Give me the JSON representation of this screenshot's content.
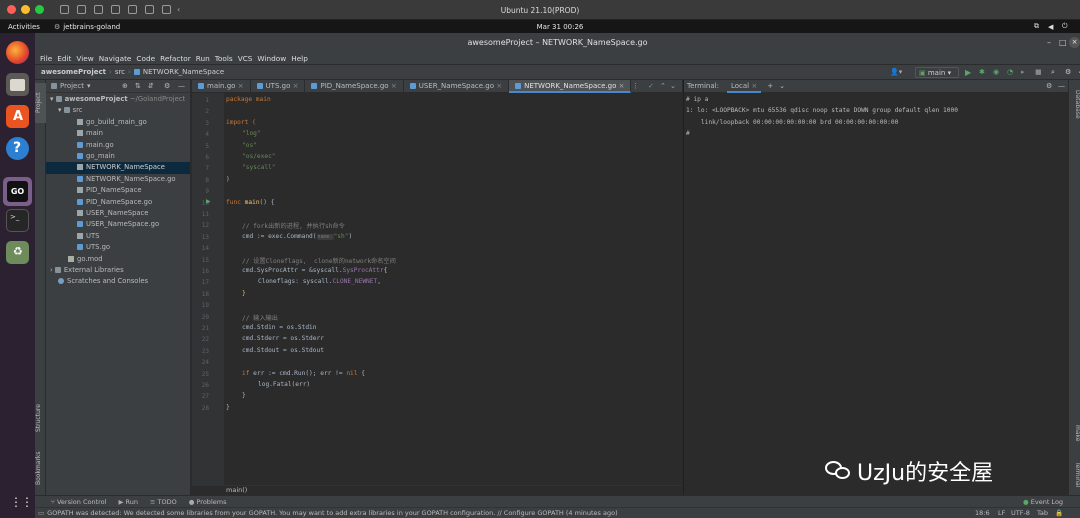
{
  "mac": {
    "vm_title": "Ubuntu 21.10(PROD)"
  },
  "ubuntu": {
    "activities": "Activities",
    "app": "jetbrains-goland",
    "clock": "Mar 31  00:26"
  },
  "window": {
    "title": "awesomeProject – NETWORK_NameSpace.go"
  },
  "menu": [
    "File",
    "Edit",
    "View",
    "Navigate",
    "Code",
    "Refactor",
    "Run",
    "Tools",
    "VCS",
    "Window",
    "Help"
  ],
  "nav": {
    "crumbs": [
      "awesomeProject",
      "src",
      "NETWORK_NameSpace"
    ],
    "run_config": "main"
  },
  "left_strip": {
    "project": "Project",
    "structure": "Structure",
    "bookmarks": "Bookmarks"
  },
  "right_strip": {
    "database": "Database",
    "make": "make",
    "terminal": "Terminal"
  },
  "project": {
    "header": "Project",
    "root_name": "awesomeProject",
    "root_path": "~/GolandProject",
    "items": [
      "src",
      "go_build_main_go",
      "main",
      "main.go",
      "go_main",
      "NETWORK_NameSpace",
      "NETWORK_NameSpace.go",
      "PID_NameSpace",
      "PID_NameSpace.go",
      "USER_NameSpace",
      "USER_NameSpace.go",
      "UTS",
      "UTS.go",
      "go.mod",
      "External Libraries",
      "Scratches and Consoles"
    ]
  },
  "tabs": [
    "main.go",
    "UTS.go",
    "PID_NameSpace.go",
    "USER_NameSpace.go",
    "NETWORK_NameSpace.go"
  ],
  "editor": {
    "line_numbers": [
      "1",
      "2",
      "3",
      "4",
      "5",
      "6",
      "7",
      "8",
      "9",
      "10",
      "11",
      "12",
      "13",
      "14",
      "15",
      "16",
      "17",
      "18",
      "19",
      "20",
      "21",
      "22",
      "23",
      "24",
      "25",
      "26",
      "27",
      "28"
    ],
    "pkg": "package main",
    "import_kw": "import (",
    "imp1": "\"log\"",
    "imp2": "\"os\"",
    "imp3": "\"os/exec\"",
    "imp4": "\"syscall\"",
    "close_paren": ")",
    "func_kw": "func",
    "func_name": "main",
    "func_rest": "() {",
    "c1": "// fork出新的进程, 并执行sh命令",
    "l13a": "cmd := exec.",
    "l13b": "Command(",
    "l13hint": "name:",
    "l13str": "\"sh\"",
    "l13c": ")",
    "c2": "// 设置Cloneflags,  clone新的network命名空间",
    "l16a": "cmd.SysProcAttr = &syscall.",
    "l16b": "SysProcAttr",
    "l16c": "{",
    "l17a": "Cloneflags: syscall.",
    "l17b": "CLONE_NEWNET",
    "l17c": ",",
    "l18": "}",
    "c3": "// 输入输出",
    "l21": "cmd.Stdin = os.Stdin",
    "l22": "cmd.Stderr = os.Stderr",
    "l23": "cmd.Stdout = os.Stdout",
    "l25a": "if",
    "l25b": " err := cmd.Run(); err != ",
    "l25c": "nil",
    "l25d": " {",
    "l26": "log.Fatal(err)",
    "l27": "}",
    "l28": "}",
    "breadcrumb": "main()"
  },
  "terminal": {
    "label": "Terminal:",
    "tab": "Local",
    "lines": [
      "# ip a",
      "1: lo: <LOOPBACK> mtu 65536 qdisc noop state DOWN group default qlen 1000",
      "    link/loopback 00:00:00:00:00:00 brd 00:00:00:00:00:00",
      "#"
    ]
  },
  "toolwindows": [
    "Version Control",
    "Run",
    "TODO",
    "Problems"
  ],
  "event_log": "Event Log",
  "status": {
    "message": "GOPATH was detected: We detected some libraries from your GOPATH. You may want to add extra libraries in your GOPATH configuration. // Configure GOPATH (4 minutes ago)",
    "position": "18:6",
    "eol": "LF",
    "encoding": "UTF-8",
    "indent": "Tab"
  },
  "watermark": "UzJu的安全屋"
}
